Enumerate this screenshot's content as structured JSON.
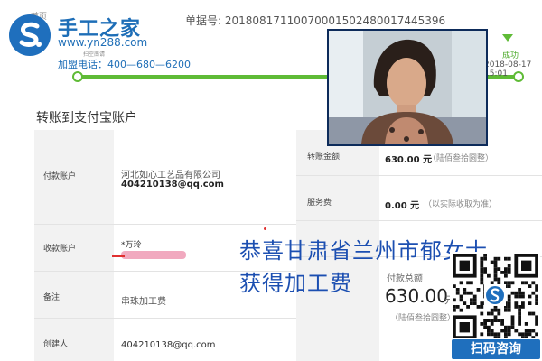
{
  "brand": {
    "tag": "首页",
    "name": "手工之家",
    "url": "www.yn288.com",
    "sub": "扫空南请",
    "hotline": "加盟电话：400—680—6200",
    "brand_color": "#1e6eb7"
  },
  "order": {
    "number_label": "单据号: 20180817110070001502480017445396"
  },
  "progress": {
    "status": "成功",
    "timestamp": "2018-08-17 15:01",
    "color": "#5fbb36"
  },
  "section_title": "转账到支付宝账户",
  "rows": {
    "payer_label": "付款账户",
    "payer_company": "河北如心工艺品有限公司",
    "payer_email": "404210138@qq.com",
    "payee_label": "收款账户",
    "payee_name": "*万玲",
    "remark_label": "备注",
    "remark_value": "串珠加工费",
    "creator_label": "创建人",
    "creator_value": "404210138@qq.com",
    "amount_label": "转账金额",
    "amount_value": "630.00 元",
    "amount_caps": "（陆佰叁拾圆整）",
    "fee_label": "服务费",
    "fee_value": "0.00 元",
    "fee_note": "（以实际收取为准）",
    "total_label": "付款总额",
    "total_value": "630.00",
    "total_unit": "元",
    "total_caps": "（陆佰叁拾圆整）"
  },
  "banner": {
    "line1": "恭喜甘肃省兰州市郁女士",
    "line2": "获得加工费",
    "color": "#1c4fb1"
  },
  "qr": {
    "button_label": "扫码咨询"
  },
  "icons": [
    "logo-s-icon",
    "qr-code-icon",
    "progress-arrow-icon"
  ]
}
